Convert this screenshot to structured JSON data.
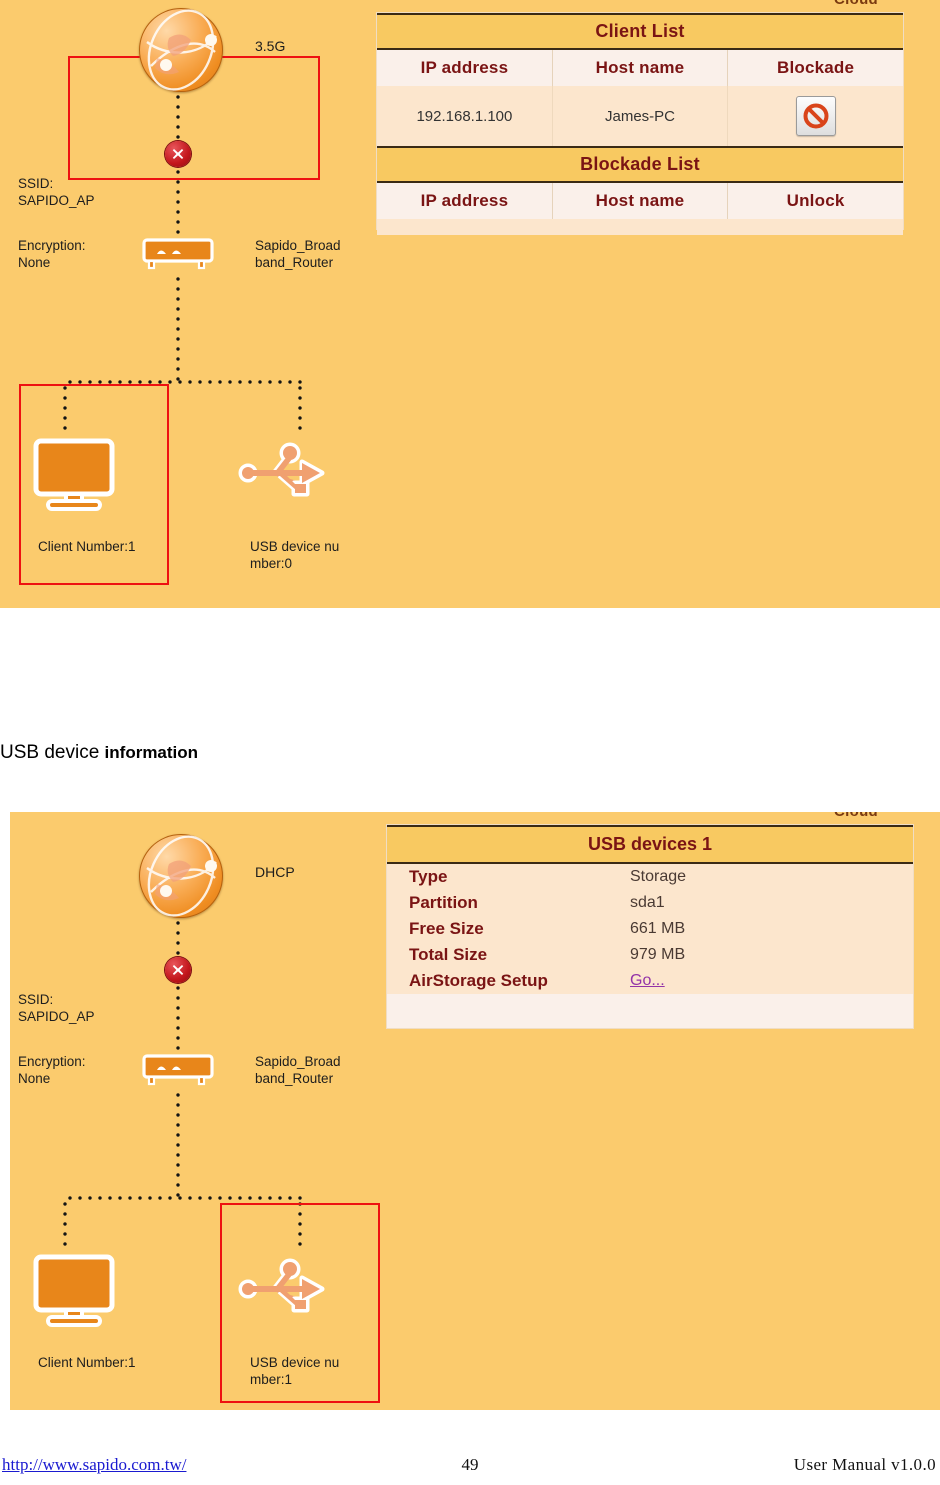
{
  "caption": {
    "text_regular": "USB device ",
    "text_bold": "information"
  },
  "panels": [
    {
      "id": "panel-one",
      "cloud_label": "Cloud",
      "wan_label": "3.5G",
      "ssid_label": "SSID:\nSAPIDO_AP",
      "encryption_label": "Encryption:\nNone",
      "router_label": "Sapido_Broad\nband_Router",
      "client_label": "Client Number:1",
      "usb_label": "USB device nu\nmber:0",
      "highlight_target": "wan-connection"
    },
    {
      "id": "panel-two",
      "cloud_label": "Cloud",
      "wan_label": "DHCP",
      "ssid_label": "SSID:\nSAPIDO_AP",
      "encryption_label": "Encryption:\nNone",
      "router_label": "Sapido_Broad\nband_Router",
      "client_label": "Client Number:1",
      "usb_label": "USB device nu\nmber:1",
      "highlight_target": "usb-device"
    }
  ],
  "client_list": {
    "title": "Client List",
    "columns": [
      "IP address",
      "Host name",
      "Blockade"
    ],
    "rows": [
      {
        "ip": "192.168.1.100",
        "host": "James-PC",
        "action_icon": "prohibition-icon"
      }
    ]
  },
  "blockade_list": {
    "title": "Blockade List",
    "columns": [
      "IP address",
      "Host name",
      "Unlock"
    ],
    "rows": []
  },
  "usb_devices": {
    "title": "USB devices 1",
    "fields": [
      {
        "key": "Type",
        "value": "Storage"
      },
      {
        "key": "Partition",
        "value": "sda1"
      },
      {
        "key": "Free Size",
        "value": "661 MB"
      },
      {
        "key": "Total Size",
        "value": "979 MB"
      }
    ],
    "setup_key": "AirStorage Setup",
    "setup_link": "Go..."
  },
  "footer": {
    "url": "http://www.sapido.com.tw/",
    "page": "49",
    "version": "User Manual v1.0.0"
  },
  "colors": {
    "panel_bg": "#FBCB6D",
    "table_title_bg": "#F8C961",
    "table_head_bg": "#FAF0EA",
    "table_data_bg": "#FCE6CD",
    "title_text": "#7A1414",
    "highlight_red": "#EE1111",
    "link_purple": "#9333A8",
    "footer_link": "#1A1AD0"
  }
}
